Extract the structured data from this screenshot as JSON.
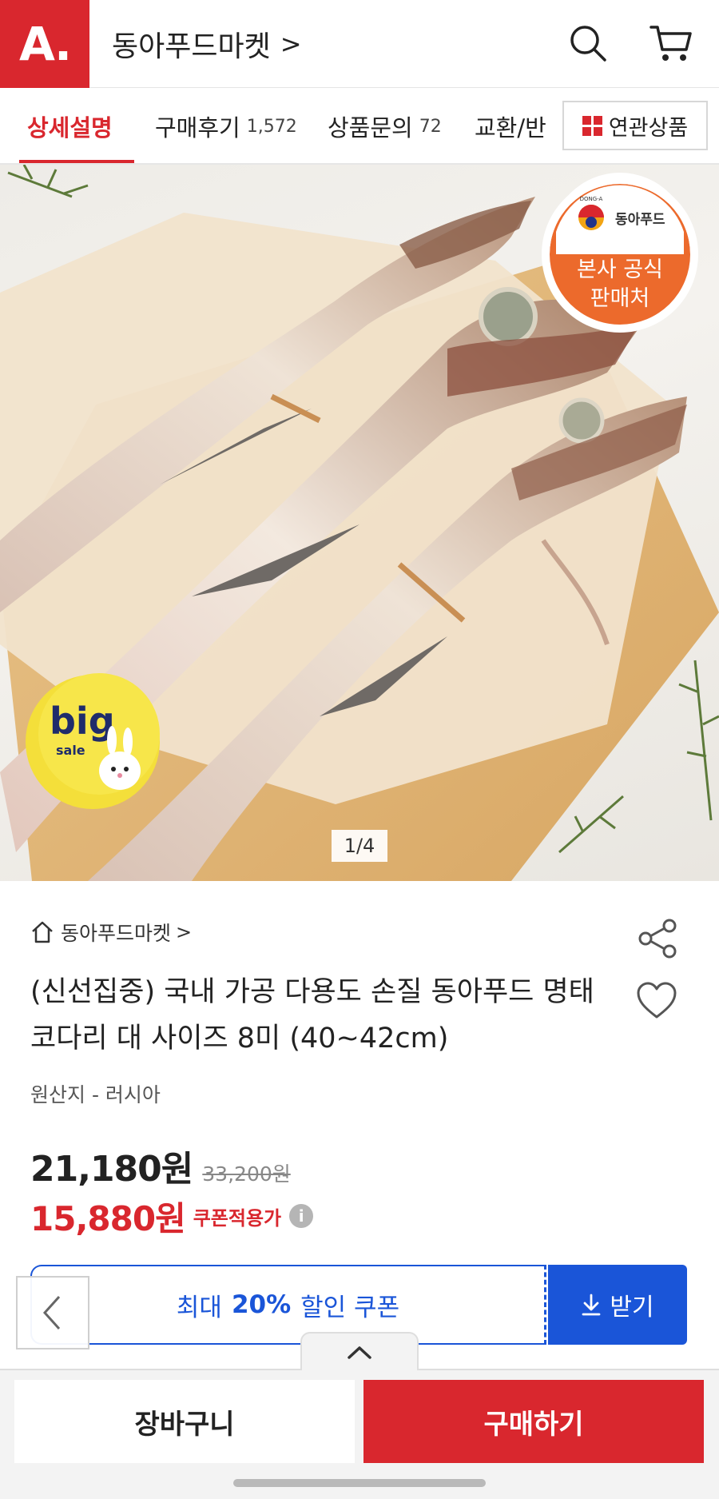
{
  "header": {
    "logo": "A.",
    "store_name": "동아푸드마켓",
    "store_chevron": ">",
    "icons": [
      "search-icon",
      "cart-icon"
    ]
  },
  "tabs": {
    "items": [
      {
        "label": "상세설명",
        "count": ""
      },
      {
        "label": "구매후기",
        "count": "1,572"
      },
      {
        "label": "상품문의",
        "count": "72"
      },
      {
        "label": "교환/반",
        "count": ""
      }
    ],
    "related_label": "연관상품"
  },
  "hero": {
    "pager": "1/4",
    "badge_brand": "동아푸드",
    "badge_brand_small": "DONG-A",
    "badge_line1": "본사 공식",
    "badge_line2": "판매처",
    "sale_big": "big",
    "sale_small": "sale"
  },
  "product": {
    "store": "동아푸드마켓",
    "store_chevron": ">",
    "title": "(신선집중) 국내 가공 다용도 손질 동아푸드 명태 코다리 대 사이즈 8미 (40~42cm)",
    "origin": "원산지 - 러시아",
    "price": "21,180원",
    "original_price": "33,200원",
    "coupon_price": "15,880원",
    "coupon_label": "쿠폰적용가",
    "info": "i"
  },
  "coupon": {
    "prefix": "최대",
    "percent": "20%",
    "suffix": "할인 쿠폰",
    "button": "받기"
  },
  "bottom": {
    "cart_label": "장바구니",
    "buy_label": "구매하기"
  },
  "colors": {
    "brand_red": "#d9272e",
    "coupon_blue": "#1a55d8",
    "badge_orange": "#ec6a2c"
  }
}
